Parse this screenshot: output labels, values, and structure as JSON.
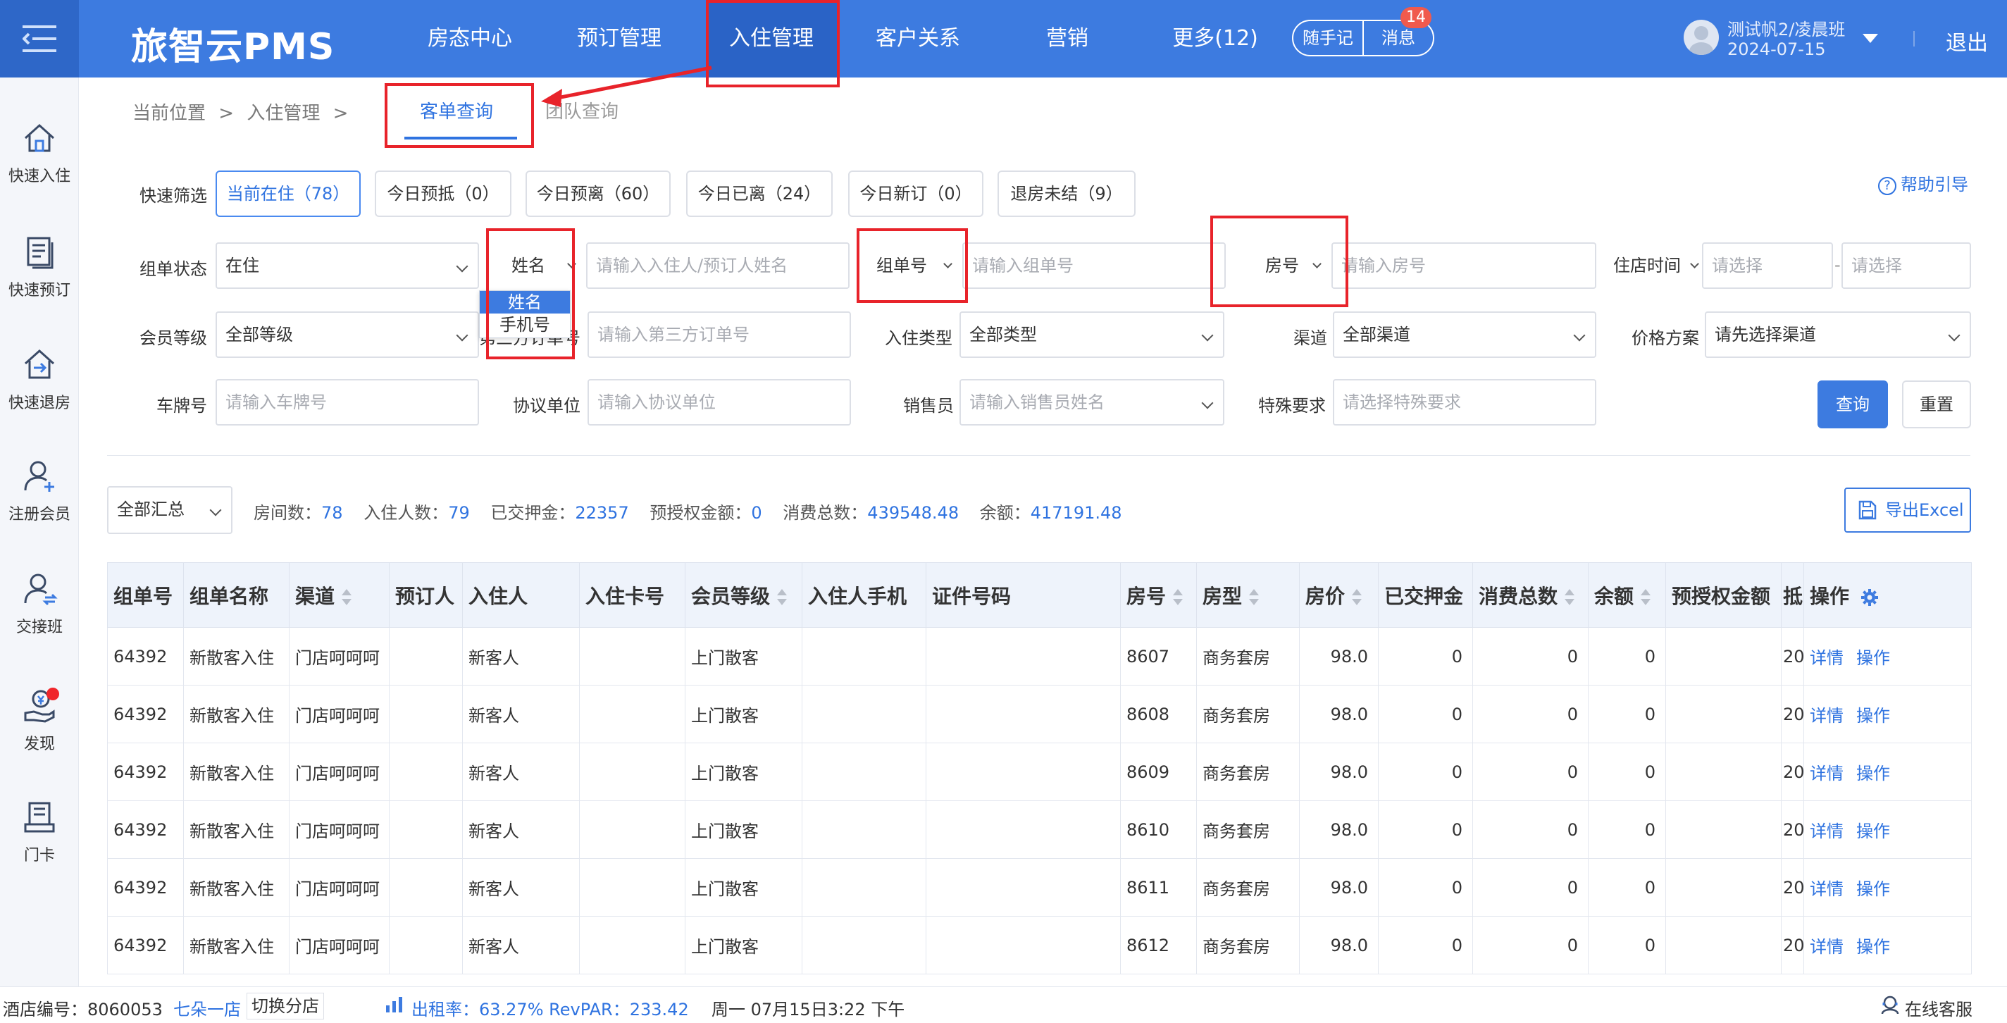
{
  "header": {
    "brand": "旅智云PMS",
    "nav": [
      "房态中心",
      "预订管理",
      "入住管理",
      "客户关系",
      "营销",
      "更多(12)"
    ],
    "notebook_label": "随手记",
    "message_label": "消息",
    "message_count": "14",
    "user_name": "测试帆2/凌晨班",
    "user_date": "2024-07-15",
    "logout": "退出"
  },
  "sidebar": [
    "快速入住",
    "快速预订",
    "快速退房",
    "注册会员",
    "交接班",
    "发现",
    "门卡"
  ],
  "breadcrumb": {
    "prefix": "当前位置",
    "sep1": ">",
    "section": "入住管理",
    "sep2": ">",
    "tabs": [
      "客单查询",
      "团队查询"
    ]
  },
  "quick_filter": {
    "label": "快速筛选",
    "chips": [
      "当前在住（78）",
      "今日预抵（0）",
      "今日预离（60）",
      "今日已离（24）",
      "今日新订（0）",
      "退房未结（9）"
    ],
    "help": "帮助引导"
  },
  "filters": {
    "order_status_label": "组单状态",
    "order_status_value": "在住",
    "name_type_value": "姓名",
    "name_placeholder": "请输入入住人/预订人姓名",
    "name_type_options": [
      "姓名",
      "手机号"
    ],
    "group_no_value": "组单号",
    "group_no_placeholder": "请输入组单号",
    "room_no_value": "房号",
    "room_no_placeholder": "请输入房号",
    "stay_time_value": "住店时间",
    "date_start_placeholder": "请选择",
    "date_sep": "-",
    "date_end_placeholder": "请选择",
    "member_level_label": "会员等级",
    "member_level_value": "全部等级",
    "third_party_label": "第三方订单号",
    "third_party_placeholder": "请输入第三方订单号",
    "checkin_type_label": "入住类型",
    "checkin_type_value": "全部类型",
    "channel_label": "渠道",
    "channel_value": "全部渠道",
    "price_plan_label": "价格方案",
    "price_plan_placeholder": "请先选择渠道",
    "plate_label": "车牌号",
    "plate_placeholder": "请输入车牌号",
    "agreement_label": "协议单位",
    "agreement_placeholder": "请输入协议单位",
    "sales_label": "销售员",
    "sales_placeholder": "请输入销售员姓名",
    "special_label": "特殊要求",
    "special_placeholder": "请选择特殊要求",
    "query_button": "查询",
    "reset_button": "重置"
  },
  "summary": {
    "scope_value": "全部汇总",
    "items": [
      {
        "label": "房间数：",
        "value": "78"
      },
      {
        "label": "入住人数：",
        "value": "79"
      },
      {
        "label": "已交押金：",
        "value": "22357"
      },
      {
        "label": "预授权金额：",
        "value": "0"
      },
      {
        "label": "消费总数：",
        "value": "439548.48"
      },
      {
        "label": "余额：",
        "value": "417191.48"
      }
    ],
    "export_label": "导出Excel"
  },
  "table": {
    "columns": [
      "组单号",
      "组单名称",
      "渠道",
      "预订人",
      "入住人",
      "入住卡号",
      "会员等级",
      "入住人手机",
      "证件号码",
      "房号",
      "房型",
      "房价",
      "已交押金",
      "消费总数",
      "余额",
      "预授权金额",
      "抵",
      "操作"
    ],
    "rows": [
      [
        "64392",
        "新散客入住",
        "门店呵呵呵",
        "",
        "新客人",
        "",
        "上门散客",
        "",
        "",
        "8607",
        "商务套房",
        "98.0",
        "0",
        "0",
        "0",
        "",
        "20",
        "详情",
        "操作"
      ],
      [
        "64392",
        "新散客入住",
        "门店呵呵呵",
        "",
        "新客人",
        "",
        "上门散客",
        "",
        "",
        "8608",
        "商务套房",
        "98.0",
        "0",
        "0",
        "0",
        "",
        "20",
        "详情",
        "操作"
      ],
      [
        "64392",
        "新散客入住",
        "门店呵呵呵",
        "",
        "新客人",
        "",
        "上门散客",
        "",
        "",
        "8609",
        "商务套房",
        "98.0",
        "0",
        "0",
        "0",
        "",
        "20",
        "详情",
        "操作"
      ],
      [
        "64392",
        "新散客入住",
        "门店呵呵呵",
        "",
        "新客人",
        "",
        "上门散客",
        "",
        "",
        "8610",
        "商务套房",
        "98.0",
        "0",
        "0",
        "0",
        "",
        "20",
        "详情",
        "操作"
      ],
      [
        "64392",
        "新散客入住",
        "门店呵呵呵",
        "",
        "新客人",
        "",
        "上门散客",
        "",
        "",
        "8611",
        "商务套房",
        "98.0",
        "0",
        "0",
        "0",
        "",
        "20",
        "详情",
        "操作"
      ],
      [
        "64392",
        "新散客入住",
        "门店呵呵呵",
        "",
        "新客人",
        "",
        "上门散客",
        "",
        "",
        "8612",
        "商务套房",
        "98.0",
        "0",
        "0",
        "0",
        "",
        "20",
        "详情",
        "操作"
      ]
    ]
  },
  "status_bar": {
    "hotel_label": "酒店编号：8060053",
    "hotel_name": "七朵一店",
    "switch_label": "切换分店",
    "occupancy": "出租率：63.27% RevPAR：233.42",
    "datetime": "周一 07月15日3:22 下午",
    "service": "在线客服"
  },
  "colors": {
    "header_bg": "#3d7be0",
    "accent": "#2f73e0",
    "annotation_red": "#e8232a"
  }
}
